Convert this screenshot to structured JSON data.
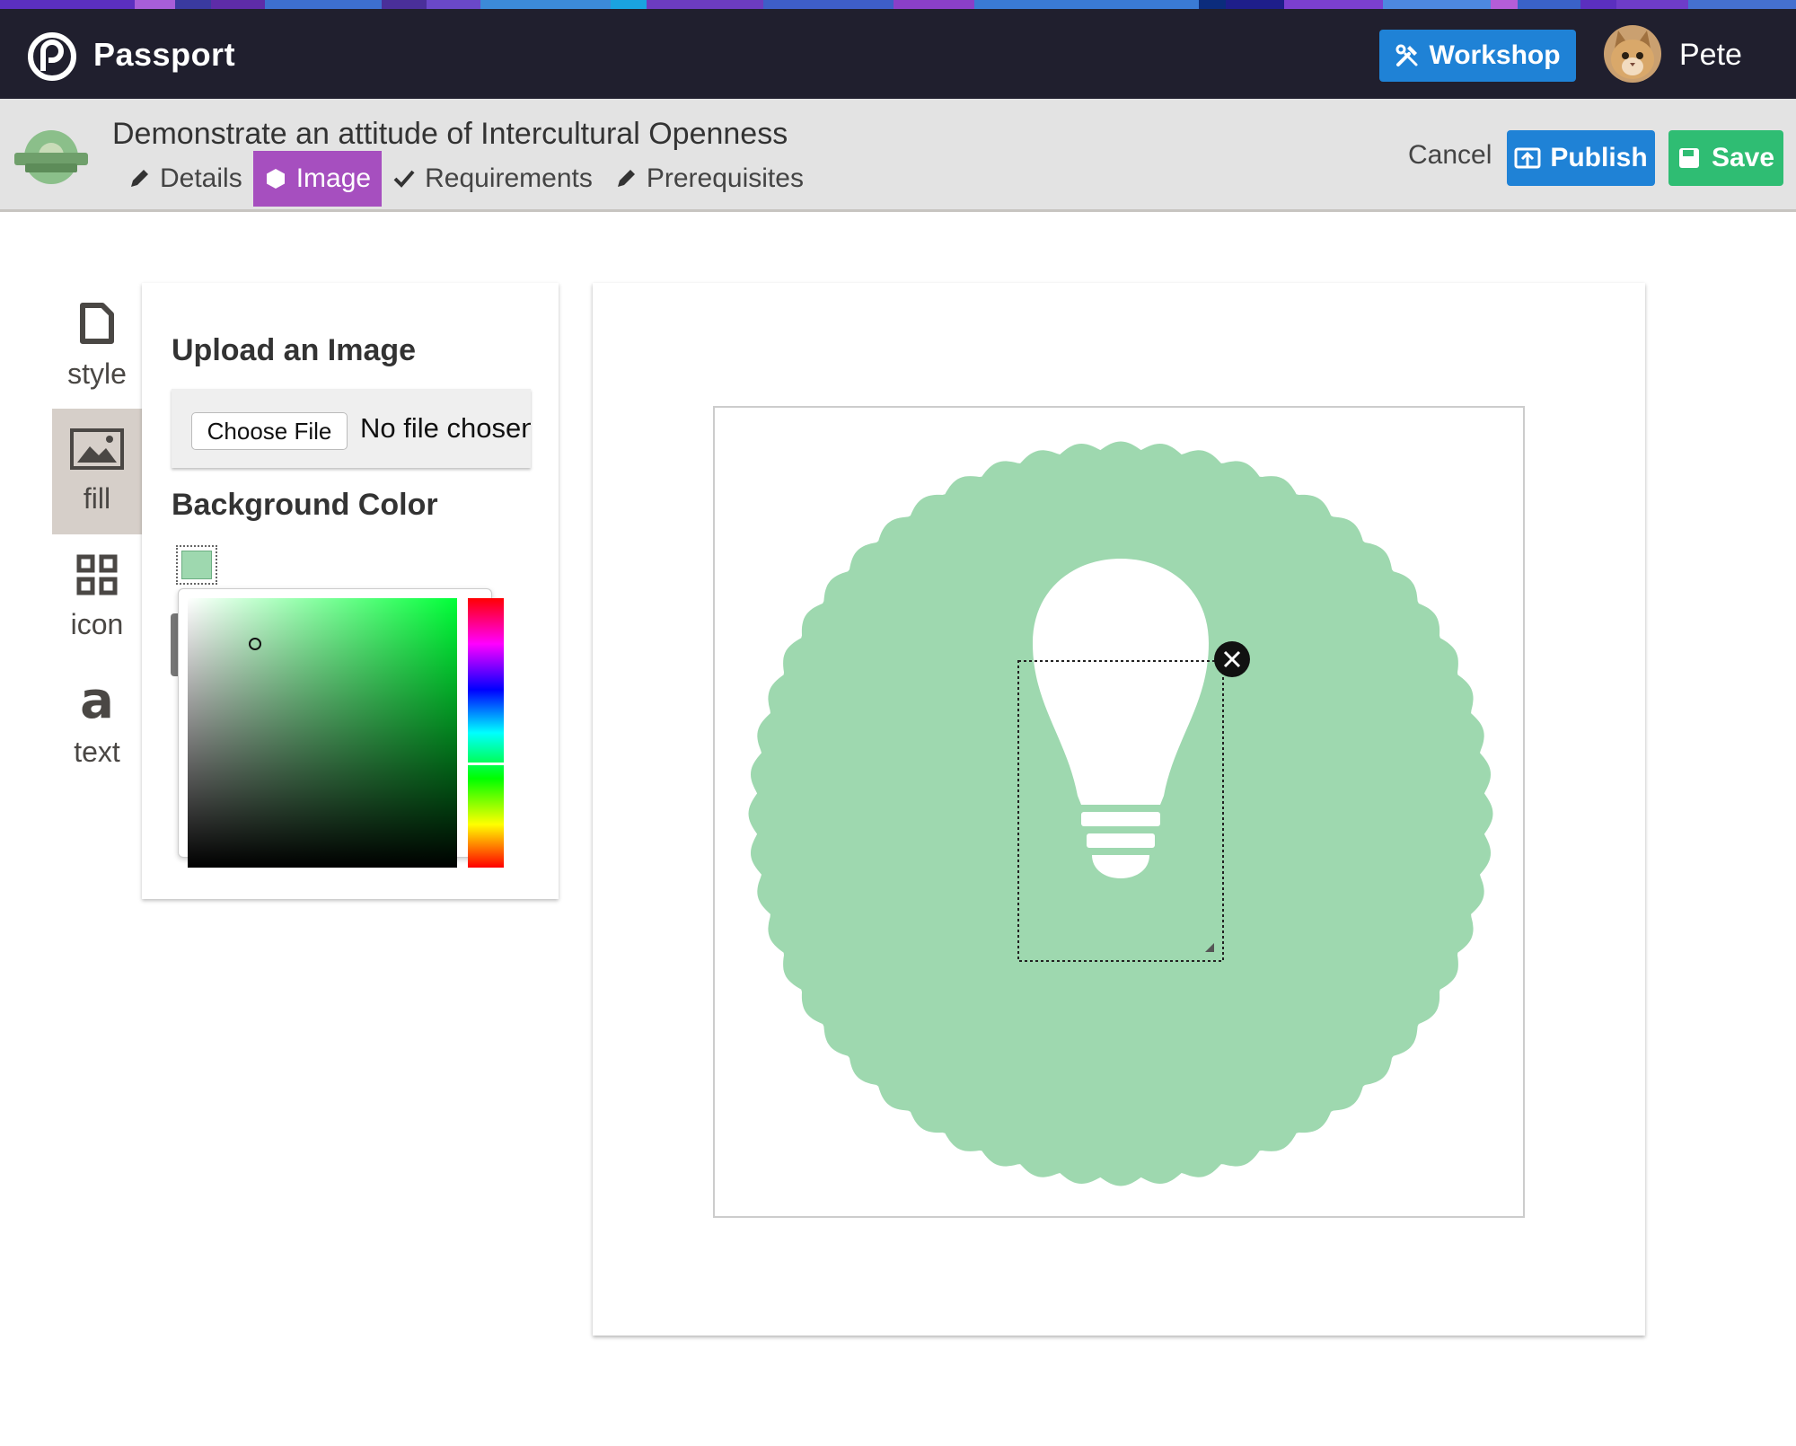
{
  "app": {
    "brand": "Passport"
  },
  "navbar": {
    "workshop_label": "Workshop",
    "user_name": "Pete"
  },
  "badge": {
    "title": "Demonstrate an attitude of Intercultural Openness"
  },
  "tabs": [
    {
      "label": "Details",
      "icon": "pencil-icon",
      "active": false
    },
    {
      "label": "Image",
      "icon": "hexagon-icon",
      "active": true
    },
    {
      "label": "Requirements",
      "icon": "checkmark-icon",
      "active": false
    },
    {
      "label": "Prerequisites",
      "icon": "pencil-icon",
      "active": false
    }
  ],
  "actions": {
    "cancel_label": "Cancel",
    "publish_label": "Publish",
    "save_label": "Save"
  },
  "rail": [
    {
      "label": "style",
      "icon": "document-icon",
      "active": false
    },
    {
      "label": "fill",
      "icon": "image-icon",
      "active": true
    },
    {
      "label": "icon",
      "icon": "grid-icon",
      "active": false
    },
    {
      "label": "text",
      "icon": "letter-a-icon",
      "active": false
    }
  ],
  "panel": {
    "upload_heading": "Upload an Image",
    "choose_file_label": "Choose File",
    "no_file_text": "No file chosen",
    "bg_color_heading": "Background Color"
  },
  "colors": {
    "badge_fill": "#9ed8af",
    "accent_purple": "#a64fbf",
    "primary_blue": "#1f82d6",
    "save_green": "#2fbd73",
    "navbar_bg": "#201f2e",
    "picker_hue": "#00ff38"
  }
}
